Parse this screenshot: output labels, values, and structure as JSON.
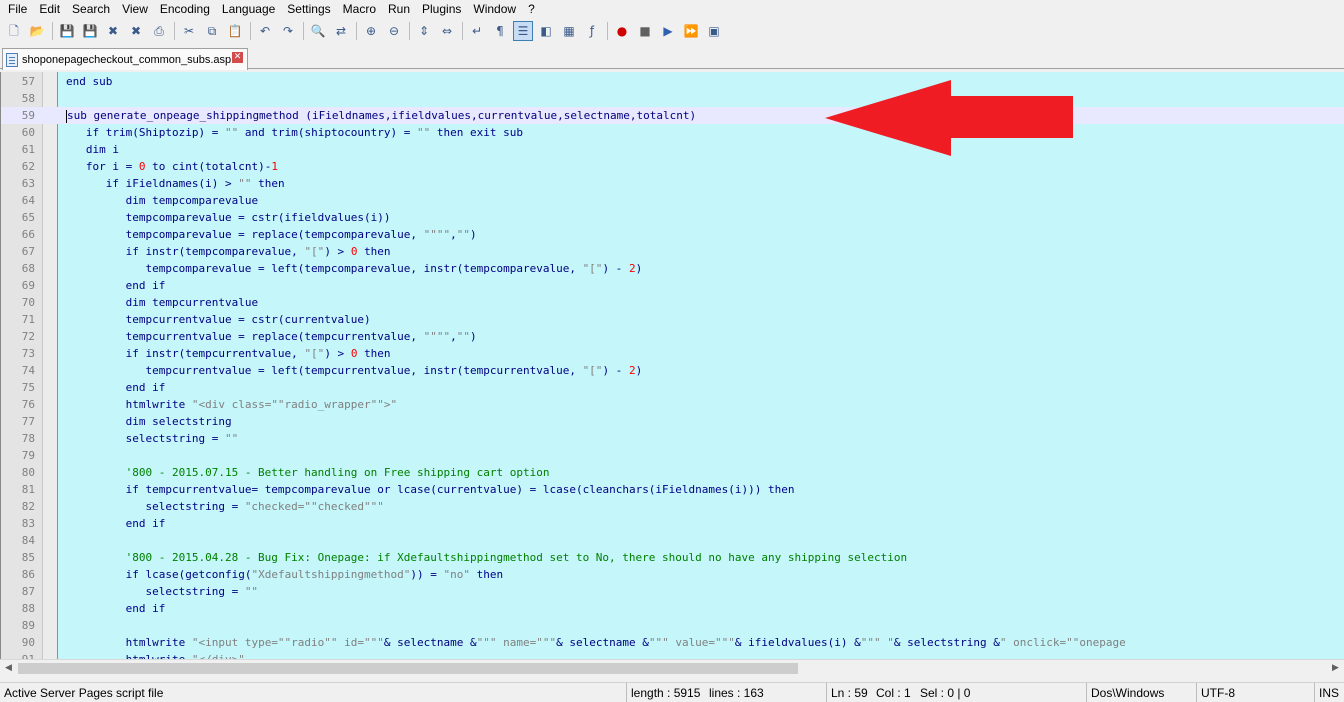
{
  "menu": [
    "File",
    "Edit",
    "Search",
    "View",
    "Encoding",
    "Language",
    "Settings",
    "Macro",
    "Run",
    "Plugins",
    "Window",
    "?"
  ],
  "toolbar": [
    "new-file-icon",
    "open-icon",
    "save-icon",
    "save-all-icon",
    "close-icon",
    "close-all-icon",
    "print-icon",
    "cut-icon",
    "copy-icon",
    "paste-icon",
    "undo-icon",
    "redo-icon",
    "find-icon",
    "replace-icon",
    "zoom-in-icon",
    "zoom-out-icon",
    "sync-vertical-icon",
    "sync-horizontal-icon",
    "word-wrap-icon",
    "show-all-chars-icon",
    "indent-guide-icon",
    "user-lang-icon",
    "doc-map-icon",
    "function-list-icon",
    "record-macro-icon",
    "stop-macro-icon",
    "play-macro-icon",
    "run-macro-multiple-icon",
    "save-macro-icon"
  ],
  "tab": {
    "label": "shoponepagecheckout_common_subs.asp",
    "close": "✕"
  },
  "editor": {
    "lines": [
      {
        "n": "57",
        "html": "<span class=\"kw\">end sub</span>"
      },
      {
        "n": "58",
        "html": ""
      },
      {
        "n": "59",
        "current": true,
        "html": "<span class=\"cur\"></span><span class=\"kw\">sub</span> generate_onpeage_shippingmethod (iFieldnames,ifieldvalues,currentvalue,selectname,totalcnt)"
      },
      {
        "n": "60",
        "html": "   <span class=\"kw\">if</span> trim(Shiptozip) = <span class=\"str\">\"\"</span> <span class=\"kw\">and</span> trim(shiptocountry) = <span class=\"str\">\"\"</span> <span class=\"kw\">then exit sub</span>"
      },
      {
        "n": "61",
        "html": "   <span class=\"kw\">dim</span> i"
      },
      {
        "n": "62",
        "html": "   <span class=\"kw\">for</span> i = <span class=\"num\">0</span> <span class=\"kw\">to</span> cint(totalcnt)-<span class=\"num\">1</span>"
      },
      {
        "n": "63",
        "html": "      <span class=\"kw\">if</span> iFieldnames(i) &gt; <span class=\"str\">\"\"</span> <span class=\"kw\">then</span>"
      },
      {
        "n": "64",
        "html": "         <span class=\"kw\">dim</span> tempcomparevalue"
      },
      {
        "n": "65",
        "html": "         tempcomparevalue = cstr(ifieldvalues(i))"
      },
      {
        "n": "66",
        "html": "         tempcomparevalue = replace(tempcomparevalue, <span class=\"str\">\"\"\"\"</span>,<span class=\"str\">\"\"</span>)"
      },
      {
        "n": "67",
        "html": "         <span class=\"kw\">if</span> instr(tempcomparevalue, <span class=\"str\">\"[\"</span>) &gt; <span class=\"num\">0</span> <span class=\"kw\">then</span>"
      },
      {
        "n": "68",
        "html": "            tempcomparevalue = left(tempcomparevalue, instr(tempcomparevalue, <span class=\"str\">\"[\"</span>) - <span class=\"num\">2</span>)"
      },
      {
        "n": "69",
        "html": "         <span class=\"kw\">end if</span>"
      },
      {
        "n": "70",
        "html": "         <span class=\"kw\">dim</span> tempcurrentvalue"
      },
      {
        "n": "71",
        "html": "         tempcurrentvalue = cstr(currentvalue)"
      },
      {
        "n": "72",
        "html": "         tempcurrentvalue = replace(tempcurrentvalue, <span class=\"str\">\"\"\"\"</span>,<span class=\"str\">\"\"</span>)"
      },
      {
        "n": "73",
        "html": "         <span class=\"kw\">if</span> instr(tempcurrentvalue, <span class=\"str\">\"[\"</span>) &gt; <span class=\"num\">0</span> <span class=\"kw\">then</span>"
      },
      {
        "n": "74",
        "html": "            tempcurrentvalue = left(tempcurrentvalue, instr(tempcurrentvalue, <span class=\"str\">\"[\"</span>) - <span class=\"num\">2</span>)"
      },
      {
        "n": "75",
        "html": "         <span class=\"kw\">end if</span>"
      },
      {
        "n": "76",
        "html": "         htmlwrite <span class=\"str\">\"&lt;div class=\"\"radio_wrapper\"\"&gt;\"</span>"
      },
      {
        "n": "77",
        "html": "         <span class=\"kw\">dim</span> selectstring"
      },
      {
        "n": "78",
        "html": "         selectstring = <span class=\"str\">\"\"</span>"
      },
      {
        "n": "79",
        "html": ""
      },
      {
        "n": "80",
        "html": "         <span class=\"cmt\">'800 - 2015.07.15 - Better handling on Free shipping cart option</span>"
      },
      {
        "n": "81",
        "html": "         <span class=\"kw\">if</span> tempcurrentvalue= tempcomparevalue <span class=\"kw\">or</span> lcase(currentvalue) = lcase(cleanchars(iFieldnames(i))) <span class=\"kw\">then</span>"
      },
      {
        "n": "82",
        "html": "            selectstring = <span class=\"str\">\"checked=\"\"checked\"\"\"</span>"
      },
      {
        "n": "83",
        "html": "         <span class=\"kw\">end if</span>"
      },
      {
        "n": "84",
        "html": ""
      },
      {
        "n": "85",
        "html": "         <span class=\"cmt\">'800 - 2015.04.28 - Bug Fix: Onepage: if Xdefaultshippingmethod set to No, there should no have any shipping selection</span>"
      },
      {
        "n": "86",
        "html": "         <span class=\"kw\">if</span> lcase(getconfig(<span class=\"str\">\"Xdefaultshippingmethod\"</span>)) = <span class=\"str\">\"no\"</span> <span class=\"kw\">then</span>"
      },
      {
        "n": "87",
        "html": "            selectstring = <span class=\"str\">\"\"</span>"
      },
      {
        "n": "88",
        "html": "         <span class=\"kw\">end if</span>"
      },
      {
        "n": "89",
        "html": ""
      },
      {
        "n": "90",
        "html": "         htmlwrite <span class=\"str\">\"&lt;input type=\"\"radio\"\" id=\"\"\"</span>&amp; selectname &amp;<span class=\"str\">\"\"\" name=\"\"\"</span>&amp; selectname &amp;<span class=\"str\">\"\"\" value=\"\"\"</span>&amp; ifieldvalues(i) &amp;<span class=\"str\">\"\"\" \"</span>&amp; selectstring &amp;<span class=\"str\">\" onclick=\"\"onepage</span>"
      },
      {
        "n": "91",
        "html": "         htmlwrite <span class=\"str\">\"&lt;/div&gt;\"</span>"
      }
    ]
  },
  "scrollbar": {
    "left": "◀",
    "right": "▶"
  },
  "status": {
    "file_type": "Active Server Pages script file",
    "length": "length : 5915",
    "lines": "lines : 163",
    "ln": "Ln : 59",
    "col": "Col : 1",
    "sel": "Sel : 0 | 0",
    "eol": "Dos\\Windows",
    "encoding": "UTF-8",
    "mode": "INS"
  },
  "colors": {
    "editor_bg": "#c4f6fa",
    "current_line": "#e8e8ff",
    "keyword": "#00008b",
    "string": "#808080",
    "number": "#ff0000",
    "comment": "#008000",
    "annotation_arrow": "#ef1c24"
  }
}
